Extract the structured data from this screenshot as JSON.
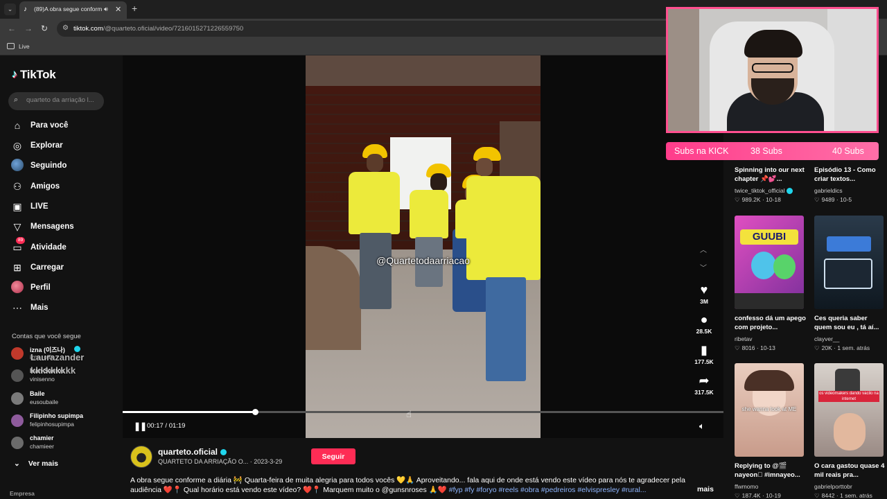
{
  "browser": {
    "tab_title": "(89)A obra segue conforme a diária",
    "url_domain": "tiktok.com",
    "url_path": "/@quarteto.oficial/video/7216015271226559750",
    "bookmark_folder": "Live"
  },
  "sidebar": {
    "logo_text": "TikTok",
    "search_placeholder": "quarteto da arriação l...",
    "nav": [
      {
        "label": "Para você",
        "icon": "home-icon"
      },
      {
        "label": "Explorar",
        "icon": "compass-icon"
      },
      {
        "label": "Seguindo",
        "icon": "avatar-icon"
      },
      {
        "label": "Amigos",
        "icon": "friends-icon"
      },
      {
        "label": "LIVE",
        "icon": "live-icon"
      },
      {
        "label": "Mensagens",
        "icon": "send-icon"
      },
      {
        "label": "Atividade",
        "icon": "inbox-icon",
        "badge": "89"
      },
      {
        "label": "Carregar",
        "icon": "plus-icon"
      },
      {
        "label": "Perfil",
        "icon": "profile-avatar"
      },
      {
        "label": "Mais",
        "icon": "more-icon"
      }
    ],
    "following_title": "Contas que você segue",
    "following": [
      {
        "name": "izna (이즈나)",
        "handle": "izna_offic",
        "verified": true,
        "color": "#c0392b"
      },
      {
        "name": "Ivan Santos",
        "handle": "vinisenno",
        "verified": false,
        "color": "#555555"
      },
      {
        "name": "Baile",
        "handle": "eusoubaile",
        "verified": false,
        "color": "#7a7a7a"
      },
      {
        "name": "Filipinho supimpa",
        "handle": "felipinhosupimpa",
        "verified": false,
        "color": "#8e5b9c"
      },
      {
        "name": "chamier",
        "handle": "chamieer",
        "verified": false,
        "color": "#6b6b6b"
      }
    ],
    "overlay_names": [
      "Laurazander",
      "kkkkkkkkk"
    ],
    "see_more": "Ver mais",
    "footer_label": "Empresa"
  },
  "video": {
    "watermark": "@Quartetodaarriacao",
    "likes": "3M",
    "comments": "28.5K",
    "saves": "177.5K",
    "shares": "317.5K",
    "time": "00:17 / 01:19",
    "progress": 0.22
  },
  "post": {
    "author": "quarteto.oficial",
    "author_sub": "QUARTETO DA ARRIAÇÃO O...",
    "date": "2023-3-29",
    "follow_label": "Seguir",
    "description": "A obra segue conforme a diária 🚧 Quarta-feira de muita alegria para todos vocês 💛🙏 Aproveitando... fala aqui de onde está vendo este vídeo para nós te agradecer pela audiência ❤️📍 Qual horário está vendo este vídeo? ❤️📍 Marquem muito o @gunsnroses 🙏❤️ ",
    "hashtags": "#fyp #fy #foryo #reels #obra #pedreiros #elvispresley #rural...",
    "more_label": "mais"
  },
  "recommendations": [
    {
      "title": "Spinning into our next chapter 📌💕...",
      "author": "twice_tiktok_official",
      "verified": true,
      "likes": "989.2K",
      "date": "10-18",
      "thumb": "#6b5a7a"
    },
    {
      "title": "Episódio 13 - Como criar textos...",
      "author": "gabrieldics",
      "verified": false,
      "likes": "9489",
      "date": "10-5",
      "thumb": "#3c4b5c"
    },
    {
      "title": "confesso dá um apego com projeto...",
      "author": "ribetav",
      "verified": false,
      "likes": "8016",
      "date": "10-13",
      "thumb": "#d24bb6"
    },
    {
      "title": "Ces queria saber quem sou eu , tá aí...",
      "author": "clayver__",
      "verified": false,
      "likes": "20K",
      "date": "1 sem. atrás",
      "thumb": "#1e2c3a"
    },
    {
      "title": "Replying to @🎬 nayeon🏻 #imnayeo...",
      "author": "ffwmomo",
      "verified": false,
      "likes": "187.4K",
      "date": "10-19",
      "thumb": "#e6c2b2"
    },
    {
      "title": "O cara gastou quase 4 mil reais pra...",
      "author": "gabrielporttobr",
      "verified": false,
      "likes": "8442",
      "date": "1 sem. atrás",
      "thumb": "#b9a7a0"
    }
  ],
  "recommendation_texts": {
    "tile3": "GUUBI",
    "tile5": "she wanna look at ME",
    "tile6": "os videomakers dando vacilo na internet"
  },
  "stream_overlay": {
    "label": "Subs na KICK",
    "subs_current": "38 Subs",
    "subs_goal": "40 Subs"
  }
}
